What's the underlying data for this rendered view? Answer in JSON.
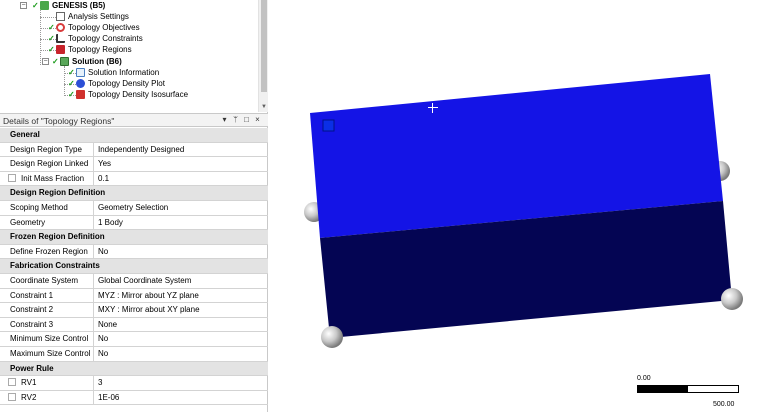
{
  "tree": {
    "root": {
      "label": "GENESIS (B5)"
    },
    "items": [
      {
        "label": "Analysis Settings"
      },
      {
        "label": "Topology Objectives"
      },
      {
        "label": "Topology Constraints"
      },
      {
        "label": "Topology Regions"
      }
    ],
    "solution": {
      "label": "Solution (B6)"
    },
    "solution_items": [
      {
        "label": "Solution Information"
      },
      {
        "label": "Topology Density Plot"
      },
      {
        "label": "Topology Density Isosurface"
      }
    ]
  },
  "details": {
    "title": "Details of \"Topology Regions\"",
    "controls": {
      "dropdown": "▾",
      "pin": "ᛘ",
      "maximize": "□",
      "close": "×"
    },
    "sections": [
      {
        "title": "General",
        "rows": [
          {
            "key": "Design Region Type",
            "value": "Independently Designed"
          },
          {
            "key": "Design Region Linked",
            "value": "Yes"
          },
          {
            "key": "Init Mass Fraction",
            "value": "0.1",
            "checkbox": true
          }
        ]
      },
      {
        "title": "Design Region Definition",
        "rows": [
          {
            "key": "Scoping Method",
            "value": "Geometry Selection"
          },
          {
            "key": "Geometry",
            "value": "1 Body"
          }
        ]
      },
      {
        "title": "Frozen Region Definition",
        "rows": [
          {
            "key": "Define Frozen Region",
            "value": "No"
          }
        ]
      },
      {
        "title": "Fabrication Constraints",
        "rows": [
          {
            "key": "Coordinate System",
            "value": "Global Coordinate System"
          },
          {
            "key": "Constraint 1",
            "value": "MYZ : Mirror about YZ plane"
          },
          {
            "key": "Constraint 2",
            "value": "MXY : Mirror about XY plane"
          },
          {
            "key": "Constraint 3",
            "value": "None"
          },
          {
            "key": "Minimum Size Control",
            "value": "No"
          },
          {
            "key": "Maximum Size Control",
            "value": "No"
          }
        ]
      },
      {
        "title": "Power Rule",
        "rows": [
          {
            "key": "RV1",
            "value": "3",
            "checkbox": true
          },
          {
            "key": "RV2",
            "value": "1E-06",
            "checkbox": true
          }
        ]
      }
    ]
  },
  "viewport": {
    "colors": {
      "top_face": "#1414e6",
      "bottom_face": "#040553",
      "corner_sphere": "#c8c8c8"
    },
    "scale": {
      "min_label": "0.00",
      "max_label": "500.00"
    }
  },
  "icons": {
    "root": "genesis-icon",
    "items": [
      "analysis-settings-icon",
      "target-icon",
      "constraint-icon",
      "region-icon"
    ],
    "solution": "solution-icon",
    "solution_items": [
      "info-icon",
      "density-plot-icon",
      "isosurface-icon"
    ]
  }
}
